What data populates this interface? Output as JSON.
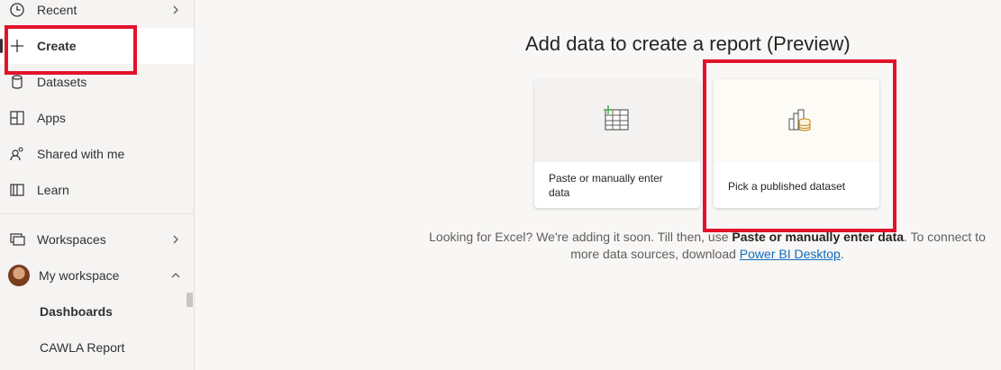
{
  "sidebar": {
    "items": [
      {
        "label": "Recent",
        "icon": "clock-icon"
      },
      {
        "label": "Create",
        "icon": "plus-icon"
      },
      {
        "label": "Datasets",
        "icon": "database-icon"
      },
      {
        "label": "Apps",
        "icon": "apps-icon"
      },
      {
        "label": "Shared with me",
        "icon": "shared-icon"
      },
      {
        "label": "Learn",
        "icon": "book-icon"
      },
      {
        "label": "Workspaces",
        "icon": "workspaces-icon"
      },
      {
        "label": "My workspace",
        "icon": "avatar"
      }
    ],
    "sub_items": [
      "Dashboards",
      "CAWLA Report"
    ]
  },
  "main": {
    "title": "Add data to create a report (Preview)",
    "cards": [
      {
        "label": "Paste or manually enter data",
        "icon": "table-icon"
      },
      {
        "label": "Pick a published dataset",
        "icon": "dataset-icon"
      }
    ],
    "info": {
      "text1": "Looking for Excel? We're adding it soon. Till then, use ",
      "bold": "Paste or manually enter data",
      "text2": ". To connect to more data sources, download ",
      "link": "Power BI Desktop",
      "text3": "."
    }
  },
  "colors": {
    "highlight": "#e3122b",
    "link": "#0f6cbd",
    "accent_green": "#4caf50",
    "dataset_gold": "#c08a1f"
  }
}
